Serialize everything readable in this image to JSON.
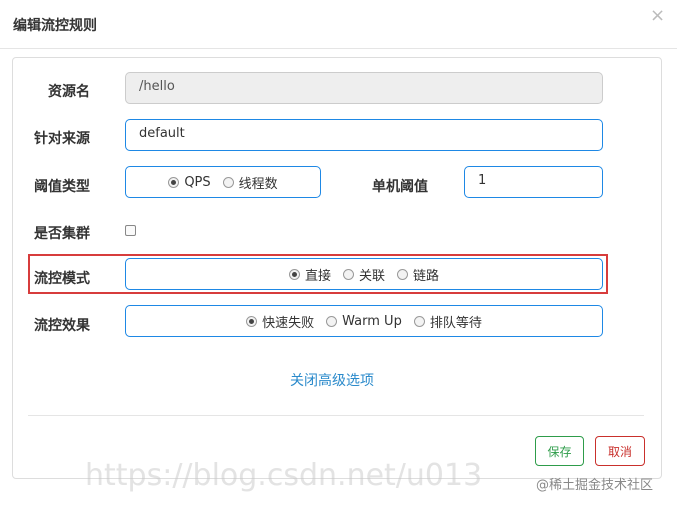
{
  "dialog": {
    "title": "编辑流控规则",
    "close_glyph": "×"
  },
  "form": {
    "resource": {
      "label": "资源名",
      "value": "/hello"
    },
    "origin": {
      "label": "针对来源",
      "value": "default"
    },
    "threshold_type": {
      "label": "阈值类型",
      "options": [
        "QPS",
        "线程数"
      ],
      "selected": "QPS"
    },
    "single_threshold": {
      "label": "单机阈值",
      "value": "1"
    },
    "cluster": {
      "label": "是否集群",
      "checked": false
    },
    "control_mode": {
      "label": "流控模式",
      "options": [
        "直接",
        "关联",
        "链路"
      ],
      "selected": "直接"
    },
    "control_effect": {
      "label": "流控效果",
      "options": [
        "快速失败",
        "Warm Up",
        "排队等待"
      ],
      "selected": "快速失败"
    },
    "advanced_link": "关闭高级选项"
  },
  "buttons": {
    "save": "保存",
    "cancel": "取消"
  },
  "watermarks": {
    "left": "https://blog.csdn.net/u013",
    "right": "@稀土掘金技术社区"
  },
  "colors": {
    "accent_blue": "#1e88e5",
    "highlight_red": "#d73c3c",
    "save_green": "#2e9c4a",
    "cancel_red": "#c9302c",
    "link_blue": "#2a8acb"
  }
}
